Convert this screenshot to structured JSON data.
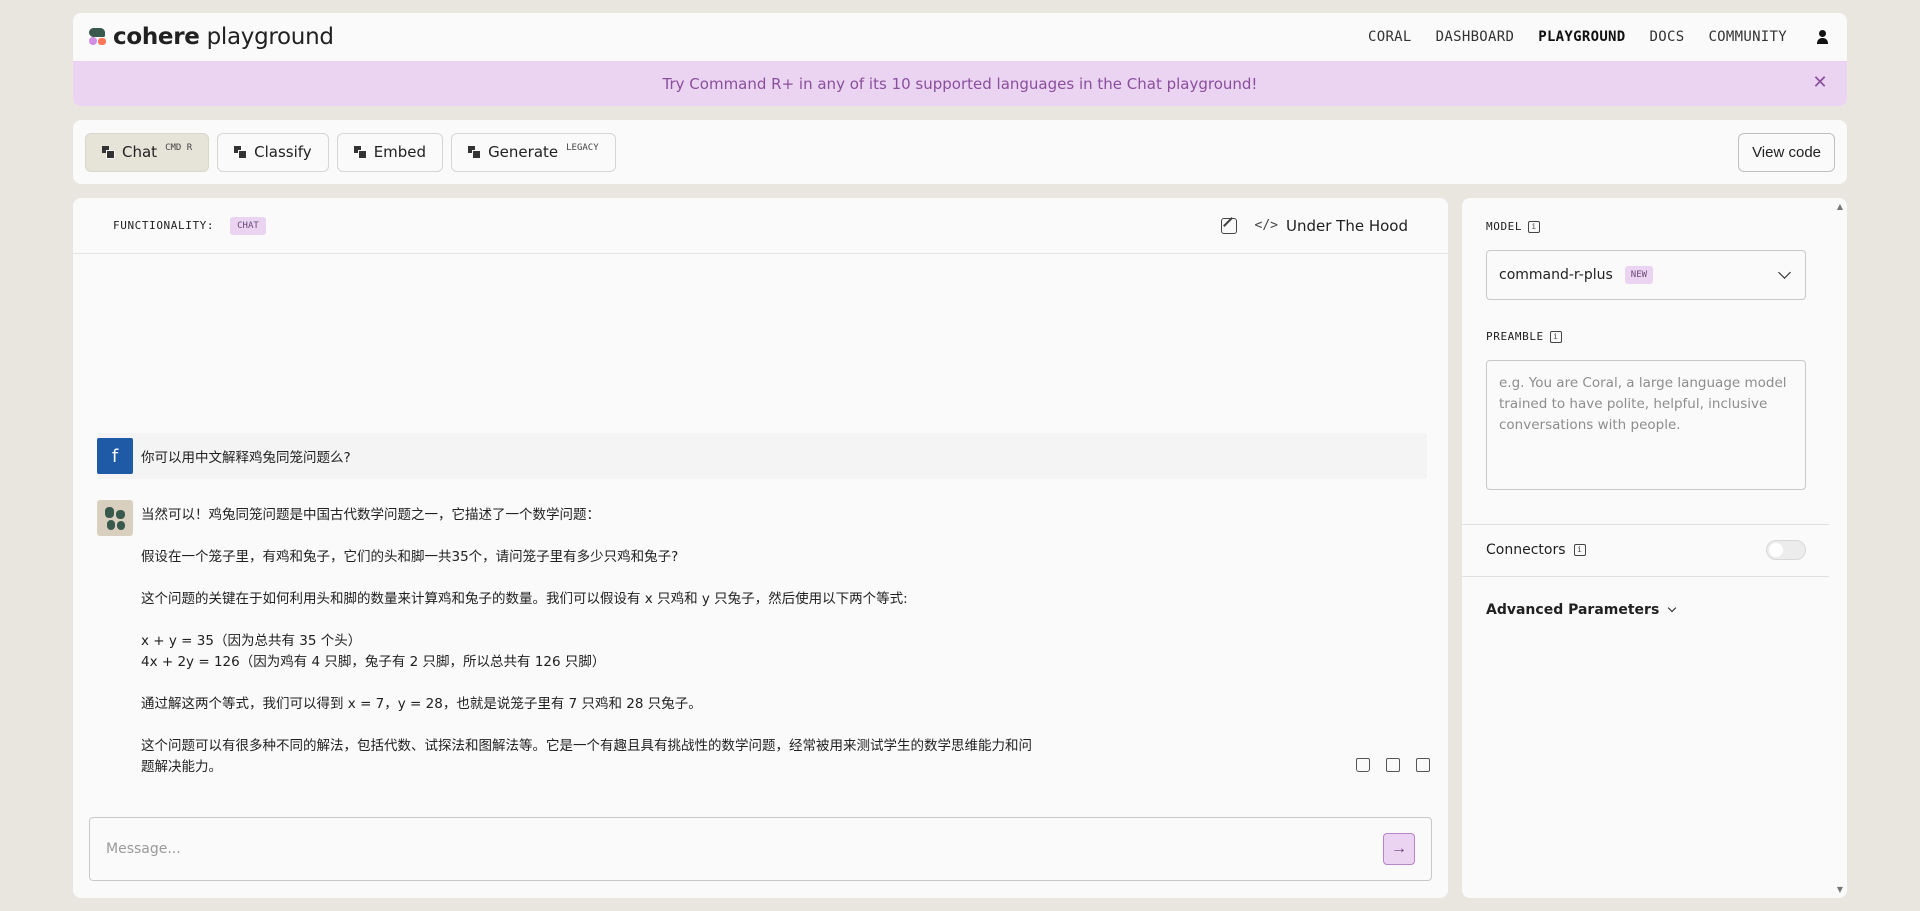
{
  "header": {
    "logo_brand": "cohere",
    "logo_product": "playground",
    "nav": [
      {
        "label": "CORAL",
        "active": false
      },
      {
        "label": "DASHBOARD",
        "active": false
      },
      {
        "label": "PLAYGROUND",
        "active": true
      },
      {
        "label": "DOCS",
        "active": false
      },
      {
        "label": "COMMUNITY",
        "active": false
      }
    ],
    "user_icon": "user-icon"
  },
  "banner": {
    "text": "Try Command R+ in any of its 10 supported languages in the Chat playground!",
    "close_icon": "close-icon"
  },
  "tabs": [
    {
      "label": "Chat",
      "badge": "CMD R",
      "active": true
    },
    {
      "label": "Classify",
      "badge": "",
      "active": false
    },
    {
      "label": "Embed",
      "badge": "",
      "active": false
    },
    {
      "label": "Generate",
      "badge": "LEGACY",
      "active": false
    }
  ],
  "view_code_label": "View code",
  "chat": {
    "functionality_label": "FUNCTIONALITY:",
    "functionality_value": "CHAT",
    "under_the_hood": "Under The Hood",
    "user_avatar_letter": "f",
    "user_message": "你可以用中文解释鸡兔同笼问题么?",
    "bot_paragraphs": [
      "当然可以！鸡兔同笼问题是中国古代数学问题之一，它描述了一个数学问题：",
      "假设在一个笼子里，有鸡和兔子，它们的头和脚一共35个，请问笼子里有多少只鸡和兔子?",
      "这个问题的关键在于如何利用头和脚的数量来计算鸡和兔子的数量。我们可以假设有 x 只鸡和 y 只兔子，然后使用以下两个等式:",
      "x + y = 35（因为总共有 35 个头）",
      "4x + 2y = 126（因为鸡有 4 只脚，兔子有 2 只脚，所以总共有 126 只脚）",
      "通过解这两个等式，我们可以得到 x = 7，y = 28，也就是说笼子里有 7 只鸡和 28 只兔子。",
      "这个问题可以有很多种不同的解法，包括代数、试探法和图解法等。它是一个有趣且具有挑战性的数学问题，经常被用来测试学生的数学思维能力和问题解决能力。"
    ],
    "composer_placeholder": "Message..."
  },
  "settings": {
    "model_label": "MODEL",
    "model_value": "command-r-plus",
    "model_badge": "NEW",
    "preamble_label": "PREAMBLE",
    "preamble_placeholder": "e.g. You are Coral, a large language model trained to have polite, helpful, inclusive conversations with people.",
    "connectors_label": "Connectors",
    "connectors_enabled": false,
    "advanced_label": "Advanced Parameters",
    "info_glyph": "i"
  },
  "colors": {
    "background": "#e8e6df",
    "panel": "#fafafa",
    "banner": "#ebd3f2",
    "brand_green": "#39594d",
    "user_avatar": "#1f5aa7"
  }
}
